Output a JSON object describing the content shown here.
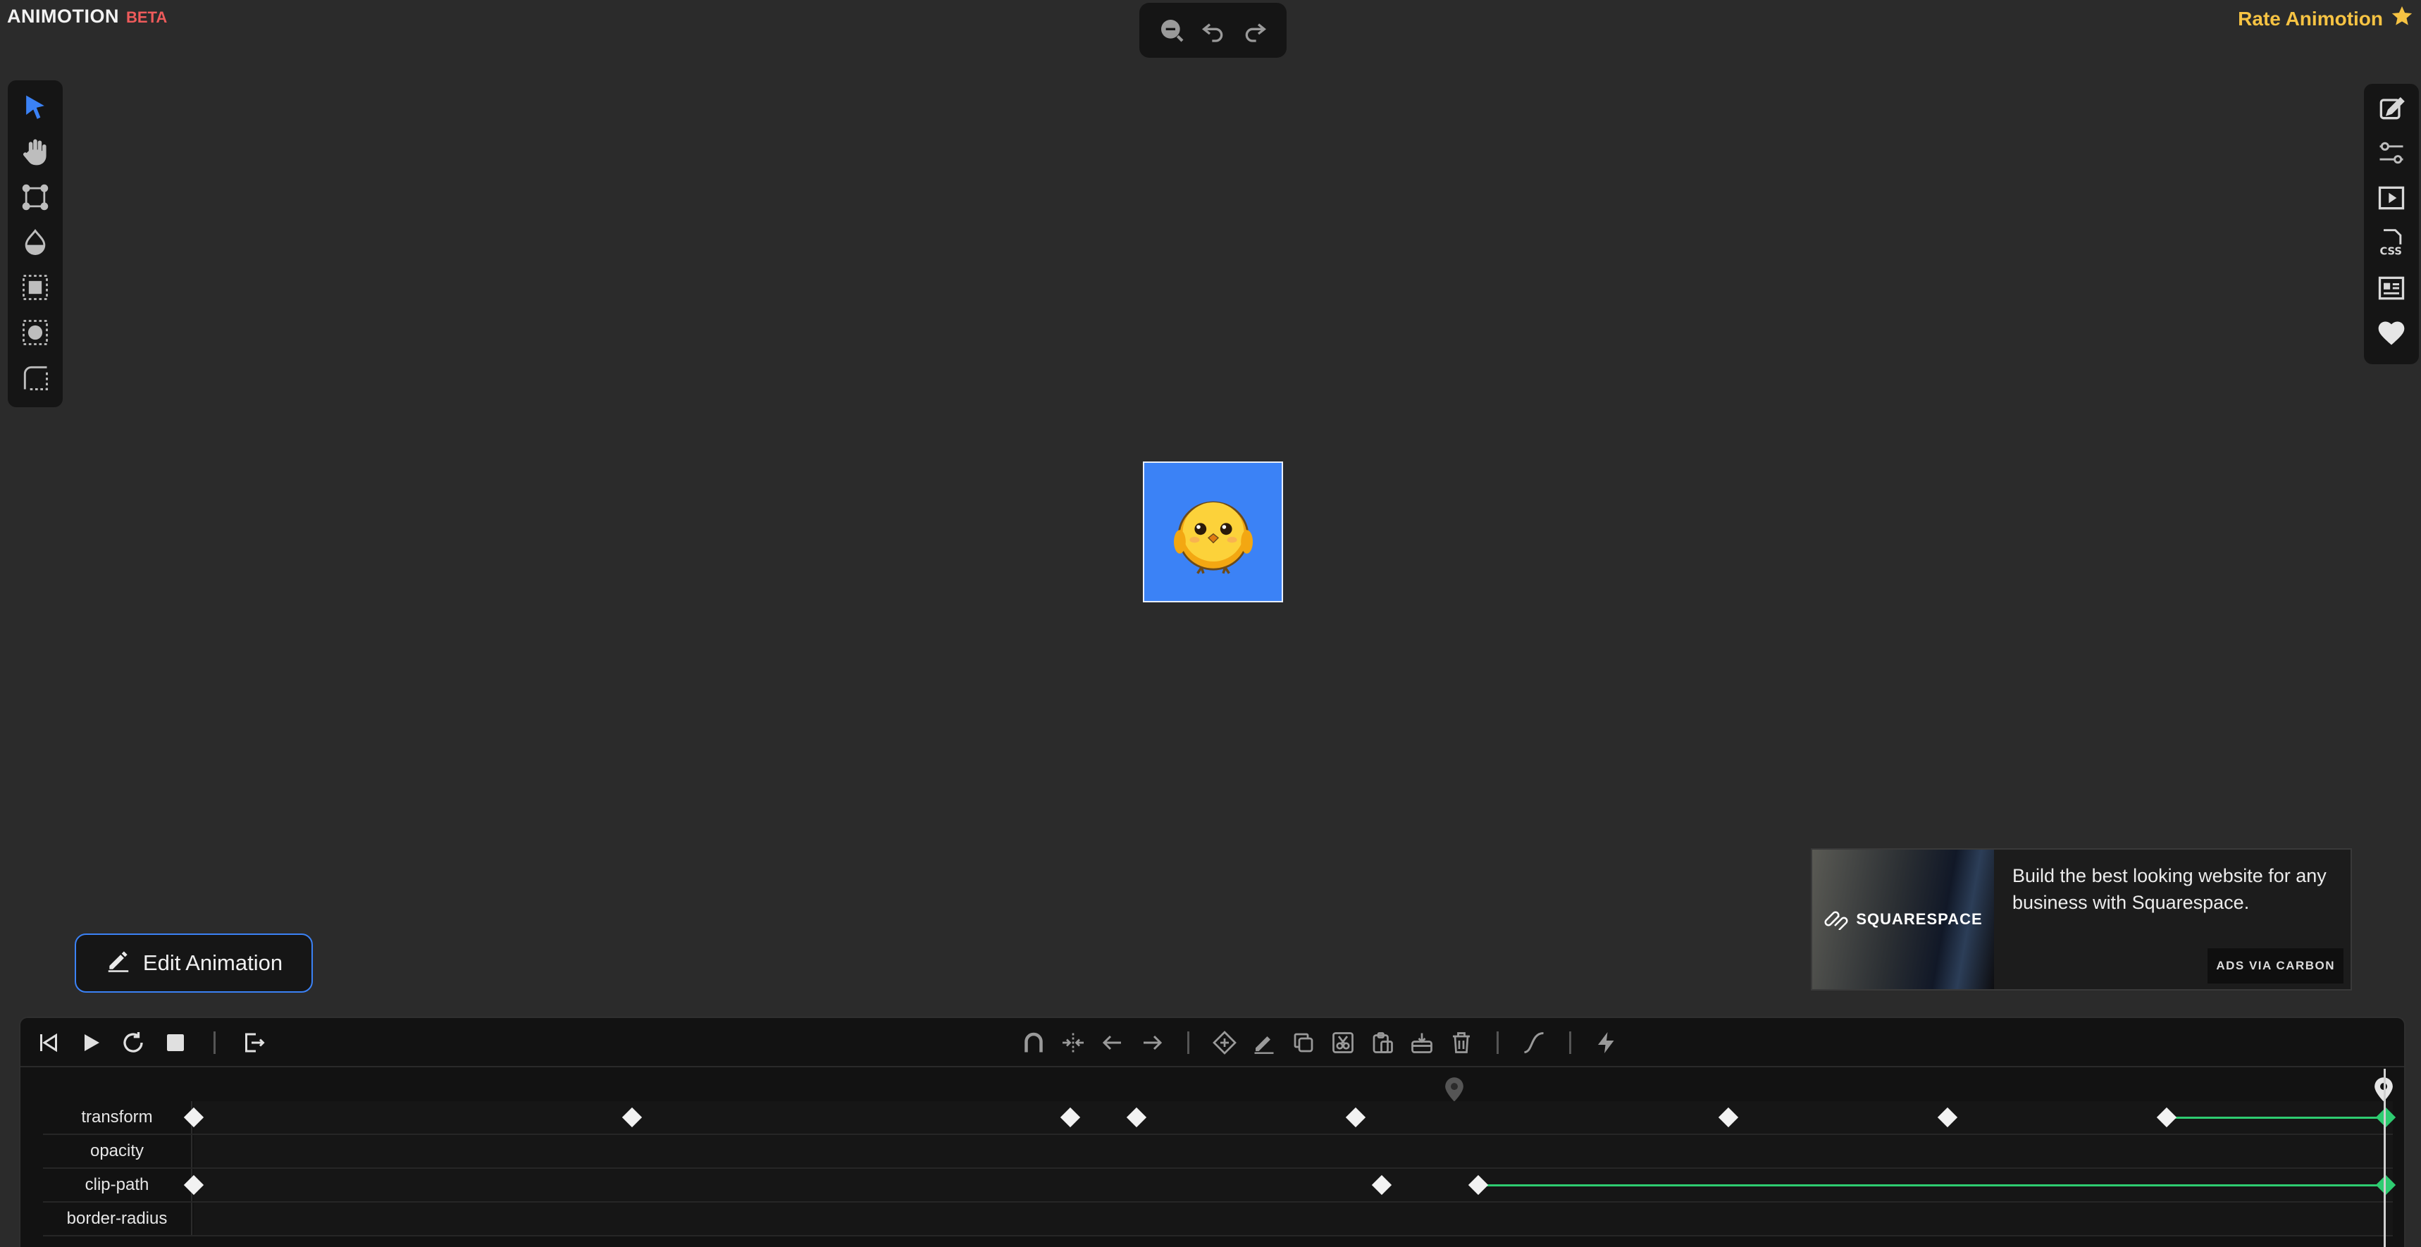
{
  "brand": {
    "name": "ANIMOTION",
    "beta": "BETA"
  },
  "rate": {
    "label": "Rate Animotion",
    "icon": "star-icon"
  },
  "topbar": {
    "items": [
      "zoom-out-icon",
      "undo-icon",
      "redo-icon"
    ]
  },
  "left_tools": [
    "select-arrow-icon",
    "hand-icon",
    "transform-points-icon",
    "color-drop-icon",
    "select-box-icon",
    "select-circle-icon",
    "corner-radius-icon"
  ],
  "right_tools": [
    "edit-note-icon",
    "settings-sliders-icon",
    "preview-play-icon",
    "css-file-icon",
    "article-icon",
    "heart-icon"
  ],
  "stage": {
    "element": "chick-image",
    "background": "#3b82f6"
  },
  "edit_button": {
    "label": "Edit Animation"
  },
  "ad": {
    "brand": "SQUARESPACE",
    "text": "Build the best looking website for any business with Squarespace.",
    "via": "ADS VIA CARBON"
  },
  "timeline": {
    "controls_left": [
      "skip-back-icon",
      "play-icon",
      "replay-icon",
      "stop-icon",
      "export-icon"
    ],
    "controls_center": [
      "magnet-icon",
      "split-icon",
      "arrow-left-icon",
      "arrow-right-icon",
      "add-keyframe-icon",
      "pen-icon",
      "copy-icon",
      "cut-icon",
      "paste-icon",
      "paste-below-icon",
      "trash-icon",
      "easing-curve-icon",
      "lightning-icon"
    ],
    "tracks": [
      {
        "label": "transform",
        "keyframes": [
          0,
          0.2,
          0.4,
          0.43,
          0.53,
          0.7,
          0.8,
          0.9,
          1.0
        ],
        "green_from": 0.9
      },
      {
        "label": "opacity",
        "keyframes": [],
        "green_from": null
      },
      {
        "label": "clip-path",
        "keyframes": [
          0,
          0.542,
          0.586,
          1.0
        ],
        "green_from": 0.586
      },
      {
        "label": "border-radius",
        "keyframes": [],
        "green_from": null
      }
    ]
  }
}
